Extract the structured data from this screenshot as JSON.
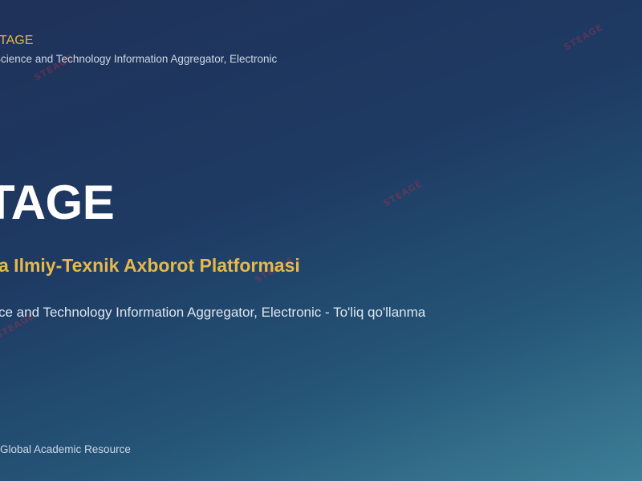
{
  "header": {
    "brand": "TAGE",
    "subtitle": "Science and Technology Information Aggregator, Electronic"
  },
  "hero": {
    "title": "TAGE",
    "subtitle": "a Ilmiy-Texnik Axborot Platformasi",
    "description": "ce and Technology Information Aggregator, Electronic - To'liq qo'llanma"
  },
  "footer": {
    "note": "Global Academic Resource"
  },
  "colors": {
    "accent": "#e6b84c",
    "background_start": "#1f3259",
    "background_end": "#3d7f97"
  }
}
